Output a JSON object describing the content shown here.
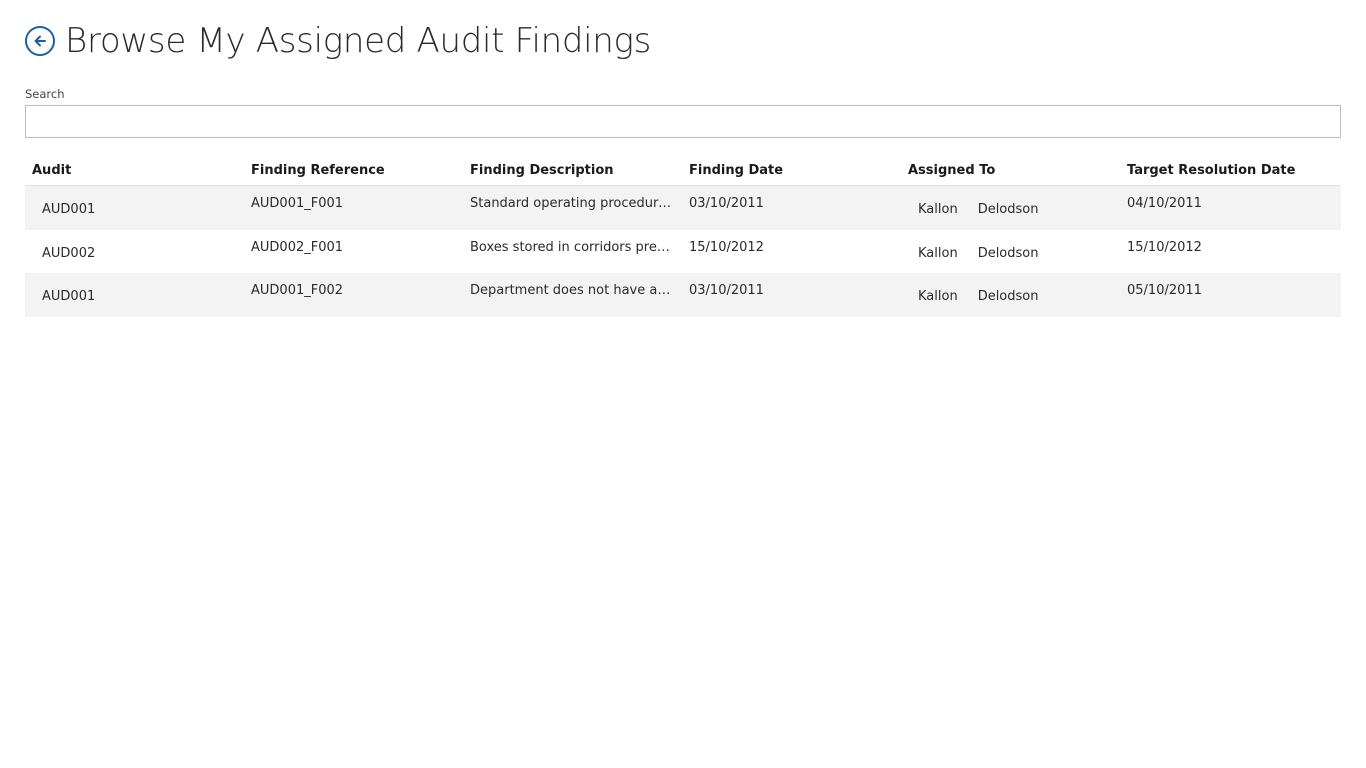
{
  "header": {
    "title": "Browse My Assigned Audit Findings",
    "back_icon": "back-arrow-circle-icon"
  },
  "search": {
    "label": "Search",
    "value": "",
    "placeholder": ""
  },
  "table": {
    "columns": [
      "Audit",
      "Finding Reference",
      "Finding Description",
      "Finding Date",
      "Assigned To",
      "Target Resolution Date"
    ],
    "rows": [
      {
        "audit": "AUD001",
        "finding_reference": "AUD001_F001",
        "finding_description": "Standard operating procedures...",
        "finding_date": "03/10/2011",
        "assigned_first": "Kallon",
        "assigned_last": "Delodson",
        "target_resolution_date": "04/10/2011"
      },
      {
        "audit": "AUD002",
        "finding_reference": "AUD002_F001",
        "finding_description": "Boxes stored in corridors prese...",
        "finding_date": "15/10/2012",
        "assigned_first": "Kallon",
        "assigned_last": "Delodson",
        "target_resolution_date": "15/10/2012"
      },
      {
        "audit": "AUD001",
        "finding_reference": "AUD001_F002",
        "finding_description": "Department does not have a lis...",
        "finding_date": "03/10/2011",
        "assigned_first": "Kallon",
        "assigned_last": "Delodson",
        "target_resolution_date": "05/10/2011"
      }
    ]
  },
  "colors": {
    "accent": "#1e5fa8",
    "row_alt": "#f3f3f3"
  }
}
